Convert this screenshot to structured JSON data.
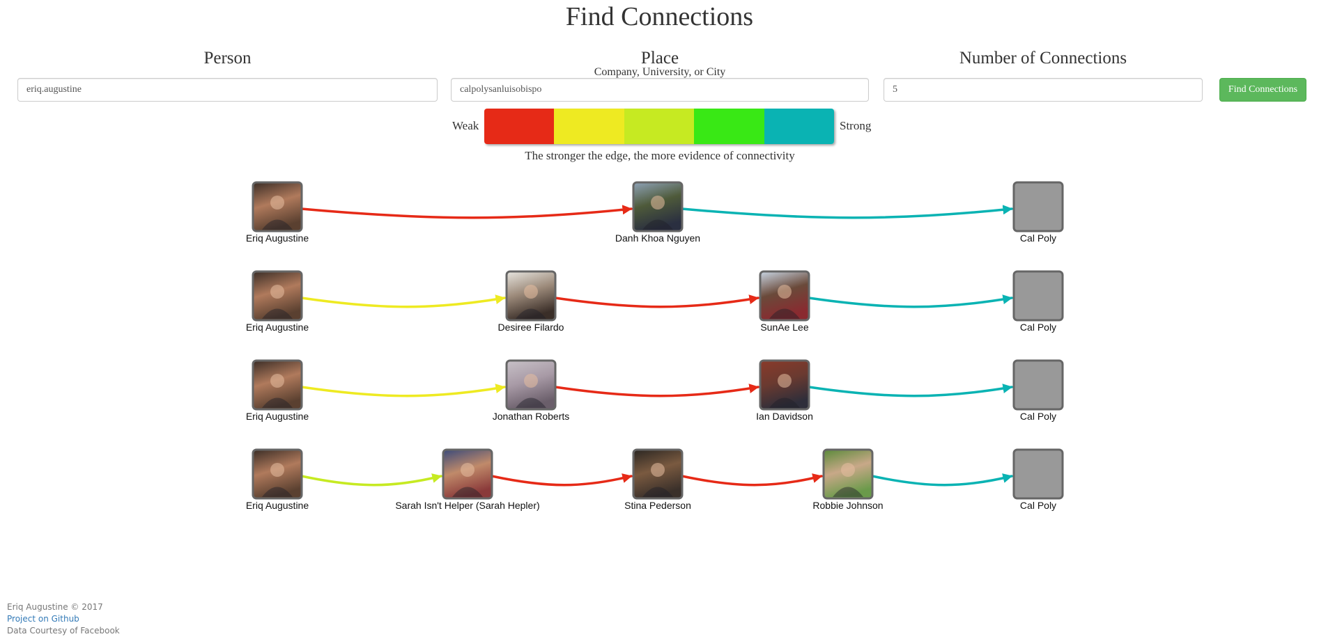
{
  "page": {
    "title": "Find Connections"
  },
  "form": {
    "person_label": "Person",
    "place_label": "Place",
    "place_sublabel": "Company, University, or City",
    "connections_label": "Number of Connections",
    "person_value": "eriq.augustine",
    "place_value": "calpolysanluisobispo",
    "connections_value": "5",
    "submit_label": "Find Connections"
  },
  "legend": {
    "weak_label": "Weak",
    "strong_label": "Strong",
    "caption": "The stronger the edge, the more evidence of connectivity",
    "colors": [
      "#e62a17",
      "#eeea22",
      "#c6ea22",
      "#39e815",
      "#0ab3b3"
    ]
  },
  "paths": [
    {
      "nodes": [
        {
          "name": "Eriq Augustine",
          "kind": "photo",
          "photo": "person-photo-eriq"
        },
        {
          "name": "Danh Khoa Nguyen",
          "kind": "photo",
          "photo": "person-photo-danh"
        },
        {
          "name": "Cal Poly",
          "kind": "place"
        }
      ],
      "edges": [
        1,
        5
      ]
    },
    {
      "nodes": [
        {
          "name": "Eriq Augustine",
          "kind": "photo",
          "photo": "person-photo-eriq"
        },
        {
          "name": "Desiree Filardo",
          "kind": "photo",
          "photo": "person-photo-desiree"
        },
        {
          "name": "SunAe Lee",
          "kind": "photo",
          "photo": "person-photo-sunae"
        },
        {
          "name": "Cal Poly",
          "kind": "place"
        }
      ],
      "edges": [
        2,
        1,
        5
      ]
    },
    {
      "nodes": [
        {
          "name": "Eriq Augustine",
          "kind": "photo",
          "photo": "person-photo-eriq"
        },
        {
          "name": "Jonathan Roberts",
          "kind": "photo",
          "photo": "person-photo-jonathan"
        },
        {
          "name": "Ian Davidson",
          "kind": "photo",
          "photo": "person-photo-ian"
        },
        {
          "name": "Cal Poly",
          "kind": "place"
        }
      ],
      "edges": [
        2,
        1,
        5
      ]
    },
    {
      "nodes": [
        {
          "name": "Eriq Augustine",
          "kind": "photo",
          "photo": "person-photo-eriq"
        },
        {
          "name": "Sarah Isn't Helper (Sarah Hepler)",
          "kind": "photo",
          "photo": "person-photo-sarah"
        },
        {
          "name": "Stina Pederson",
          "kind": "photo",
          "photo": "person-photo-stina"
        },
        {
          "name": "Robbie Johnson",
          "kind": "photo",
          "photo": "person-photo-robbie"
        },
        {
          "name": "Cal Poly",
          "kind": "place"
        }
      ],
      "edges": [
        3,
        1,
        1,
        5
      ]
    }
  ],
  "footer": {
    "copyright": "Eriq Augustine © 2017",
    "github_link": "Project on Github",
    "credit": "Data Courtesy of Facebook"
  }
}
